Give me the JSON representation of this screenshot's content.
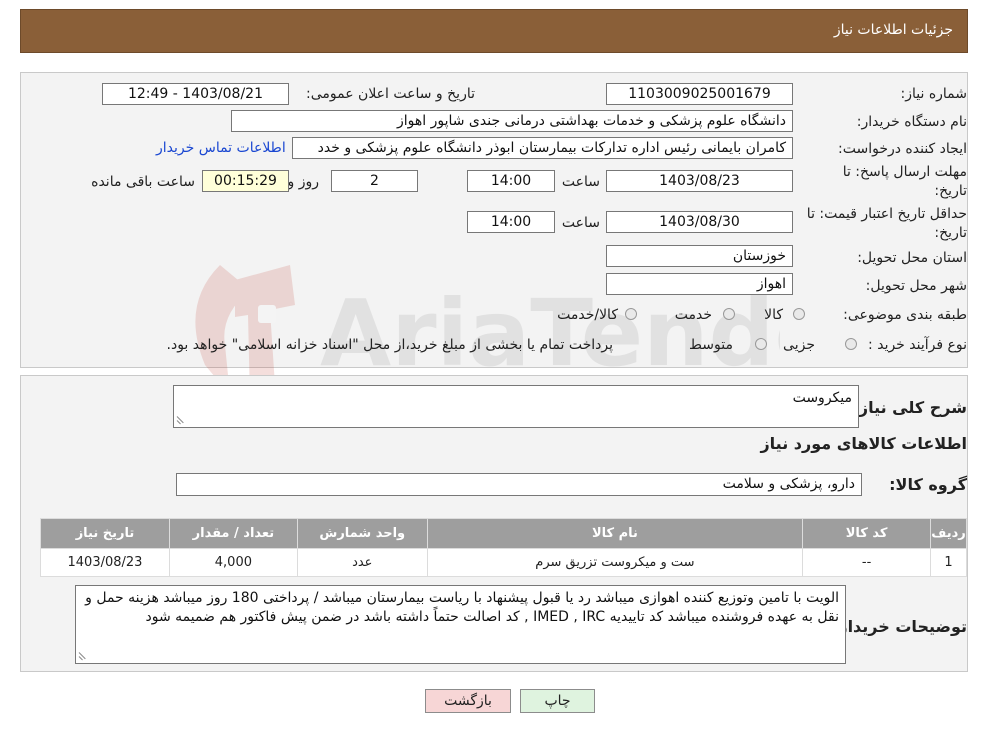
{
  "header": {
    "title": "جزئیات اطلاعات نیاز"
  },
  "fields": {
    "need_number_label": "شماره نیاز:",
    "need_number": "1103009025001679",
    "announce_label": "تاریخ و ساعت اعلان عمومی:",
    "announce_value": "1403/08/21 - 12:49",
    "buyer_org_label": "نام دستگاه خریدار:",
    "buyer_org": "دانشگاه علوم پزشکی و خدمات بهداشتی درمانی جندی شاپور اهواز",
    "creator_label": "ایجاد کننده درخواست:",
    "creator": "کامران بایمانی رئیس اداره تدارکات بیمارستان ابوذر  دانشگاه علوم پزشکی و خدد",
    "contact_link": "اطلاعات تماس خریدار",
    "deadline_label_1": "مهلت ارسال پاسخ: تا",
    "deadline_label_2": "تاریخ:",
    "deadline_date": "1403/08/23",
    "time_label": "ساعت",
    "deadline_time": "14:00",
    "days_value": "2",
    "days_label": "روز و",
    "remaining_time": "00:15:29",
    "remaining_label": "ساعت باقی مانده",
    "price_valid_label_1": "حداقل تاریخ اعتبار قیمت: تا",
    "price_valid_label_2": "تاریخ:",
    "price_valid_date": "1403/08/30",
    "price_valid_time": "14:00",
    "province_label": "استان محل تحویل:",
    "province": "خوزستان",
    "city_label": "شهر محل تحویل:",
    "city": "اهواز",
    "category_label": "طبقه بندی موضوعی:",
    "category_options": [
      "کالا",
      "خدمت",
      "کالا/خدمت"
    ],
    "process_label": "نوع فرآیند خرید :",
    "process_options": [
      "جزیی",
      "متوسط"
    ],
    "process_note": "پرداخت تمام یا بخشی از مبلغ خرید،از محل \"اسناد خزانه اسلامی\" خواهد بود."
  },
  "summary": {
    "label": "شرح کلی نیاز:",
    "value": "میکروست",
    "goods_title": "اطلاعات کالاهای مورد نیاز",
    "group_label": "گروه کالا:",
    "group_value": "دارو، پزشکی و سلامت"
  },
  "table": {
    "headers": [
      "ردیف",
      "کد کالا",
      "نام کالا",
      "واحد شمارش",
      "تعداد / مقدار",
      "تاریخ نیاز"
    ],
    "rows": [
      [
        "1",
        "--",
        "ست و میکروست تزریق سرم",
        "عدد",
        "4,000",
        "1403/08/23"
      ]
    ]
  },
  "buyer_notes": {
    "label": "توضیحات خریدار:",
    "value": "الویت با تامین وتوزیع کننده اهوازی  میباشد رد یا قبول پیشنهاد با ریاست بیمارستان میباشد / پرداختی 180 روز    میباشد هزینه حمل و نقل به عهده فروشنده میباشد   کد تاییدیه IMED , IRC , کد اصالت حتماً داشته باشد در ضمن پیش فاکتور هم ضمیمه شود"
  },
  "buttons": {
    "print": "چاپ",
    "back": "بازگشت"
  },
  "colors": {
    "header": "#8a5f38",
    "back_button": "#f7d6d6",
    "print_button": "#dff3df"
  }
}
